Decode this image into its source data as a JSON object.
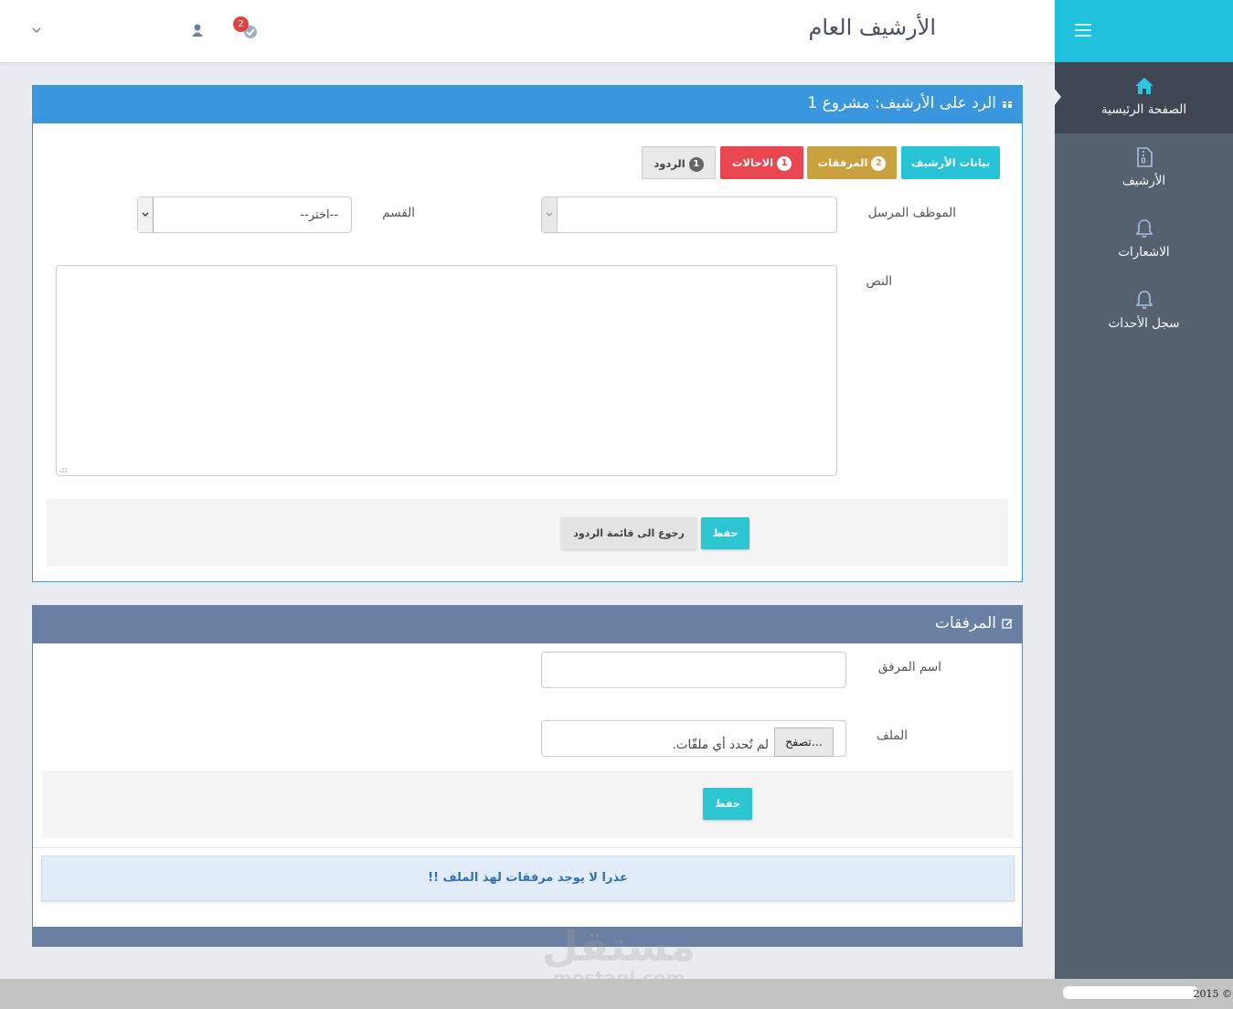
{
  "header": {
    "title": "الأرشيف العام",
    "notification_count": "2",
    "icons": {
      "user": "user-icon",
      "notifications": "notification-icon",
      "dropdown": "chevron-down-icon"
    }
  },
  "sidebar": {
    "items": [
      {
        "label": "الصفحة الرئيسية",
        "icon": "home-icon",
        "active": true
      },
      {
        "label": "الأرشيف",
        "icon": "file-archive-icon"
      },
      {
        "label": "الاشعارات",
        "icon": "bell-icon"
      },
      {
        "label": "سجل الأحداث",
        "icon": "bell-icon"
      }
    ]
  },
  "reply_panel": {
    "title": "الرد على الأرشيف: مشروع 1",
    "tabs": [
      {
        "label": "بيانات الأرشيف",
        "color": "#27c3d7"
      },
      {
        "label": "المرفقات",
        "badge": "2",
        "color": "#c9a13f"
      },
      {
        "label": "الاحالات",
        "badge": "1",
        "color": "#e8474f"
      },
      {
        "label": "الردود",
        "badge": "1",
        "color": "#e9e9e9"
      }
    ],
    "labels": {
      "employee": "الموظف المرسل",
      "department": "القسم",
      "text": "النص"
    },
    "department_select": {
      "selected": "--اختر--"
    },
    "buttons": {
      "save": "حفظ",
      "back": "رجوع الى قائمة الردود"
    }
  },
  "attach_panel": {
    "title": "المرفقات",
    "labels": {
      "name": "اسم المرفق",
      "file": "الملف"
    },
    "file_input": {
      "browse": "تصفح...",
      "none": "لم تُحدد أي ملفّات."
    },
    "buttons": {
      "save": "حفظ"
    },
    "empty_message": "عذرا لا يوجد مرفقات لهذ الملف !!"
  },
  "footer": {
    "text": "© 2015"
  },
  "watermark": {
    "line1": "مستقل",
    "line2": "mostaql.com"
  },
  "colors": {
    "sidebar": "#56616f",
    "sidebar_head": "#1ec0db",
    "primary": "#3a96dd",
    "secondary": "#6a80a2"
  }
}
